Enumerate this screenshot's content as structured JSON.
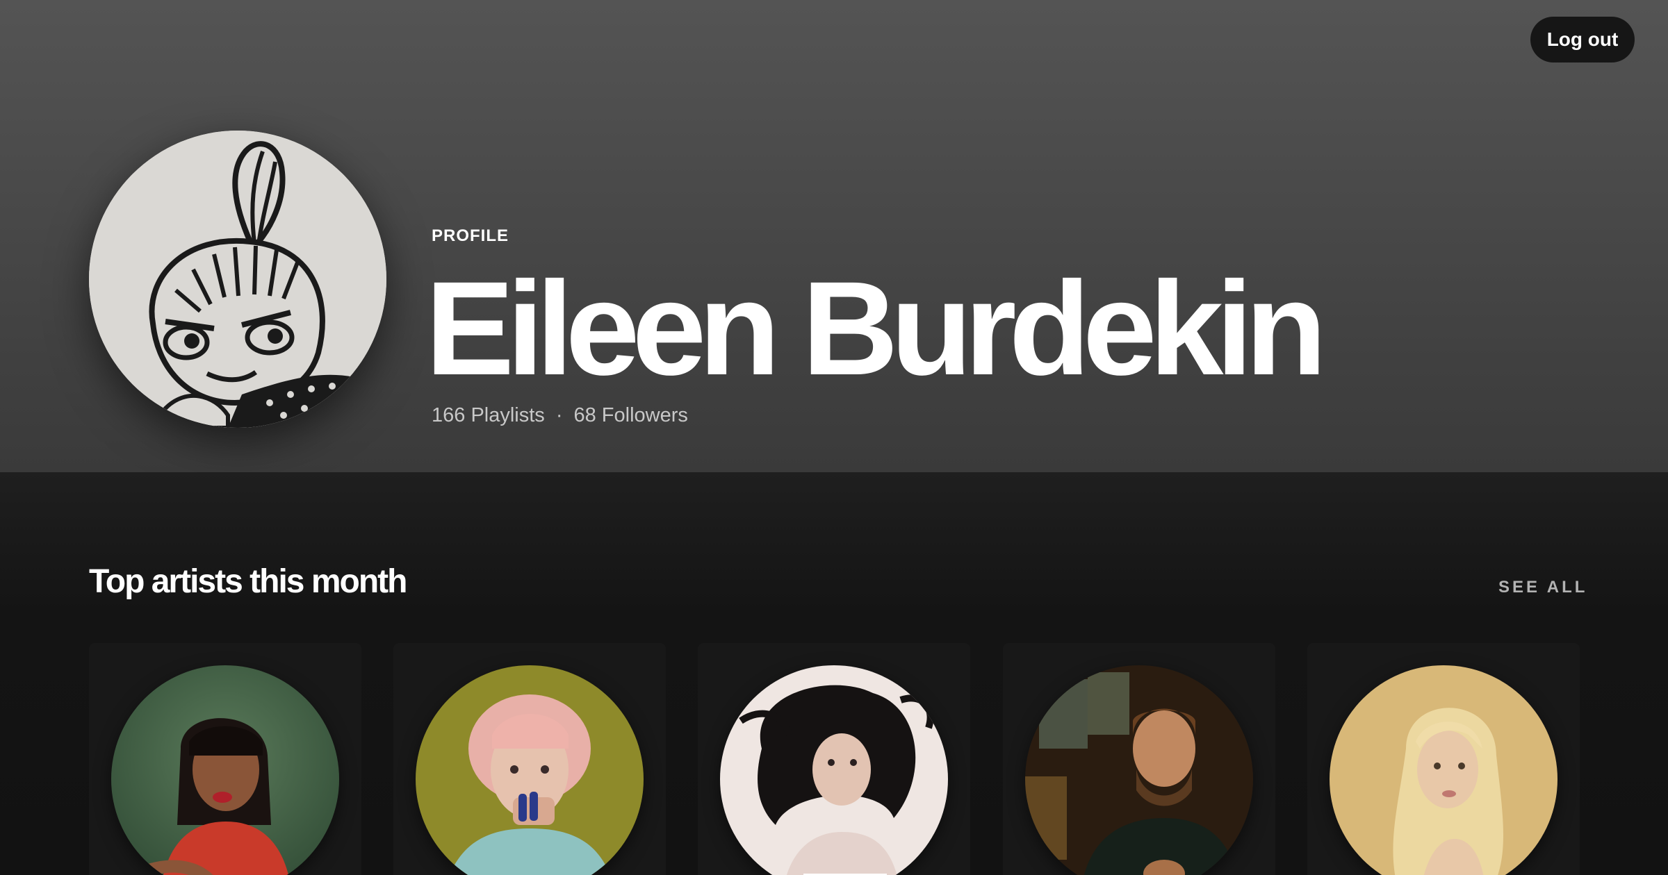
{
  "header": {
    "logout_label": "Log out",
    "profile_label": "PROFILE",
    "name": "Eileen Burdekin",
    "playlists": "166 Playlists",
    "separator": "·",
    "followers": "68 Followers"
  },
  "section": {
    "title": "Top artists this month",
    "see_all_label": "SEE ALL"
  },
  "colors": {
    "background": "#121212",
    "header_top": "#545454",
    "card": "#181818",
    "button": "#161616"
  }
}
